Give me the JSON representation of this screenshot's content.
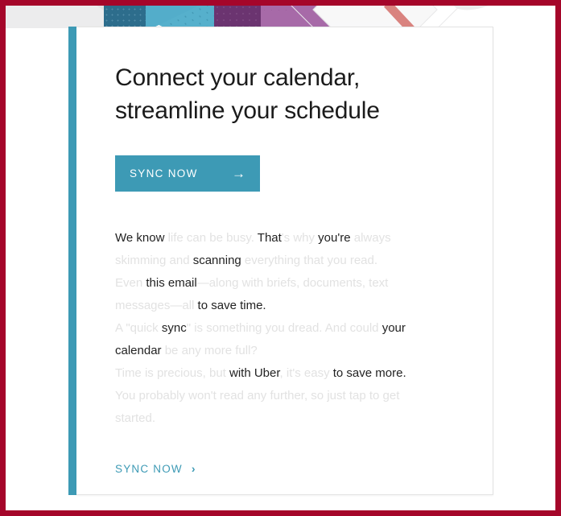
{
  "theme": {
    "frame_color": "#a5062a",
    "accent_color": "#3d9ab5",
    "card_background": "#ffffff",
    "text_read_color": "#222222",
    "text_skimmed_color": "#e2e2e2",
    "decor_teal_dark": "#2d6d8c",
    "decor_teal_light": "#56b0cc",
    "decor_purple_dark": "#6b3470",
    "decor_purple_light": "#a76aa8",
    "decor_pink": "#d98b87",
    "decor_grey": "#e9e9ea"
  },
  "card": {
    "headline": "Connect your calendar,\nstreamline your schedule",
    "cta_button": {
      "label": "SYNC NOW",
      "arrow_icon": "→"
    },
    "body_segments": [
      {
        "text": "We know ",
        "emphasis": "read"
      },
      {
        "text": "life can be busy. ",
        "emphasis": "skimmed"
      },
      {
        "text": "That",
        "emphasis": "read"
      },
      {
        "text": "'s why ",
        "emphasis": "skimmed"
      },
      {
        "text": "you're ",
        "emphasis": "read"
      },
      {
        "text": "always skimming and ",
        "emphasis": "skimmed"
      },
      {
        "text": "scanning",
        "emphasis": "read"
      },
      {
        "text": " everything that you read.",
        "emphasis": "skimmed"
      },
      {
        "text": "\n",
        "emphasis": "break"
      },
      {
        "text": "Even ",
        "emphasis": "skimmed"
      },
      {
        "text": "this email",
        "emphasis": "read"
      },
      {
        "text": "—along with briefs, documents, text messages—all ",
        "emphasis": "skimmed"
      },
      {
        "text": "to save time.",
        "emphasis": "read"
      },
      {
        "text": "\n",
        "emphasis": "break"
      },
      {
        "text": "A \"quick ",
        "emphasis": "skimmed"
      },
      {
        "text": "sync",
        "emphasis": "read"
      },
      {
        "text": "\" is something you dread. And could ",
        "emphasis": "skimmed"
      },
      {
        "text": "your calendar",
        "emphasis": "read"
      },
      {
        "text": " be any more full?",
        "emphasis": "skimmed"
      },
      {
        "text": "\n",
        "emphasis": "break"
      },
      {
        "text": "Time is precious, but ",
        "emphasis": "skimmed"
      },
      {
        "text": "with Uber",
        "emphasis": "read"
      },
      {
        "text": ", it's easy ",
        "emphasis": "skimmed"
      },
      {
        "text": "to save more.",
        "emphasis": "read"
      },
      {
        "text": "\n",
        "emphasis": "break"
      },
      {
        "text": "You probably won't read any further, so just tap to get started.",
        "emphasis": "skimmed"
      }
    ],
    "cta_link": {
      "label": "SYNC NOW",
      "chevron_icon": "›"
    }
  }
}
